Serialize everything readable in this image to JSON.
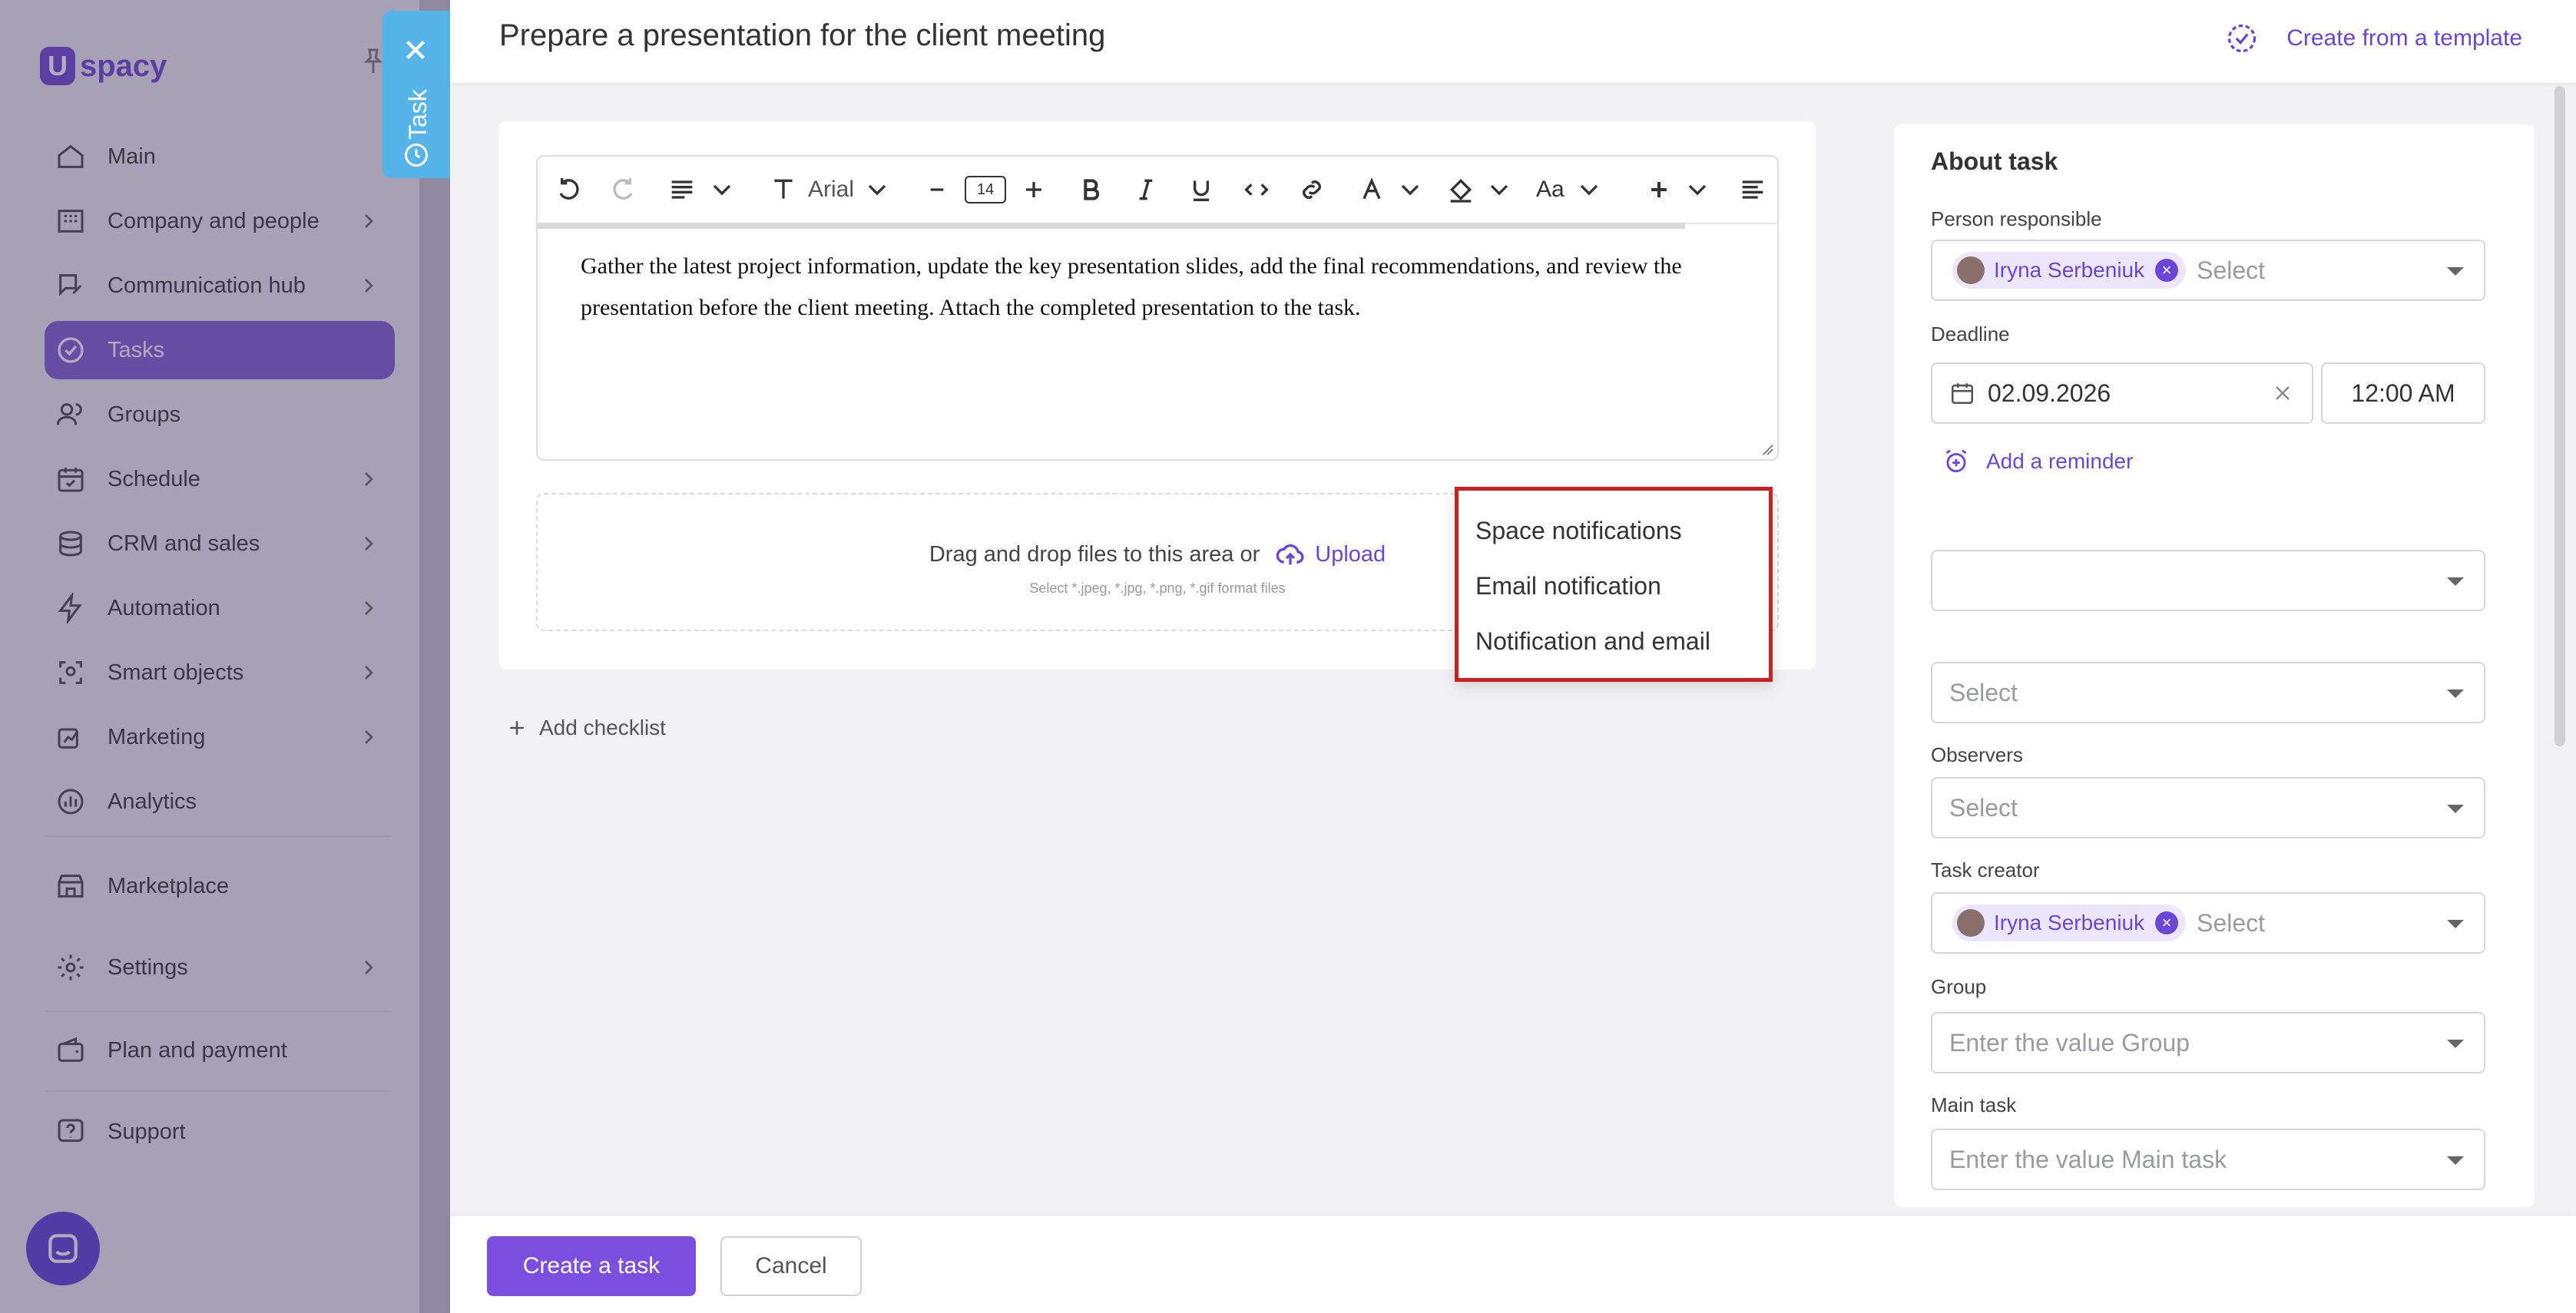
{
  "app": {
    "logo_mark": "U",
    "logo_text": "spacy"
  },
  "sidebar": {
    "items": [
      {
        "label": "Main",
        "icon": "home-icon"
      },
      {
        "label": "Company and people",
        "icon": "building-icon"
      },
      {
        "label": "Communication hub",
        "icon": "chat-edit-icon"
      },
      {
        "label": "Tasks",
        "icon": "check-circle-icon"
      },
      {
        "label": "Groups",
        "icon": "users-icon"
      },
      {
        "label": "Schedule",
        "icon": "calendar-icon"
      },
      {
        "label": "CRM and sales",
        "icon": "coins-icon"
      },
      {
        "label": "Automation",
        "icon": "lightning-icon"
      },
      {
        "label": "Smart objects",
        "icon": "scan-icon"
      },
      {
        "label": "Marketing",
        "icon": "marketing-icon"
      },
      {
        "label": "Analytics",
        "icon": "chart-icon"
      },
      {
        "label": "Marketplace",
        "icon": "store-icon"
      },
      {
        "label": "Settings",
        "icon": "gear-icon"
      },
      {
        "label": "Plan and payment",
        "icon": "wallet-icon"
      },
      {
        "label": "Support",
        "icon": "help-icon"
      }
    ]
  },
  "task_tab": {
    "label": "Task"
  },
  "header": {
    "title": "Prepare a presentation for the client meeting",
    "template_link": "Create from a template"
  },
  "editor": {
    "font_name": "Arial",
    "font_size": "14",
    "case_label": "Aa",
    "text": "Gather the latest project information, update the key presentation slides, add the final recommendations, and review the presentation before the client meeting. Attach the completed presentation to the task."
  },
  "dropzone": {
    "text": "Drag and drop files to this area or",
    "upload_label": "Upload",
    "hint": "Select *.jpeg, *.jpg, *.png, *.gif format files"
  },
  "checklist": {
    "add_label": "Add checklist"
  },
  "about": {
    "title": "About task",
    "person_responsible": {
      "label": "Person responsible",
      "chip": "Iryna Serbeniuk",
      "placeholder": "Select"
    },
    "deadline": {
      "label": "Deadline",
      "date": "02.09.2026",
      "time": "12:00 AM"
    },
    "reminder_label": "Add a reminder",
    "field_4": {
      "placeholder": "Select"
    },
    "observers": {
      "label": "Observers",
      "placeholder": "Select"
    },
    "task_creator": {
      "label": "Task creator",
      "chip": "Iryna Serbeniuk",
      "placeholder": "Select"
    },
    "group": {
      "label": "Group",
      "placeholder": "Enter the value Group"
    },
    "main_task": {
      "label": "Main task",
      "placeholder": "Enter the value Main task"
    }
  },
  "reminder_dropdown": {
    "options": [
      "Space notifications",
      "Email notification",
      "Notification and email"
    ]
  },
  "footer": {
    "create_label": "Create a task",
    "cancel_label": "Cancel"
  },
  "colors": {
    "accent": "#7c4fe0",
    "task_tab": "#56b4e9",
    "highlight_border": "#cc1f1f"
  }
}
